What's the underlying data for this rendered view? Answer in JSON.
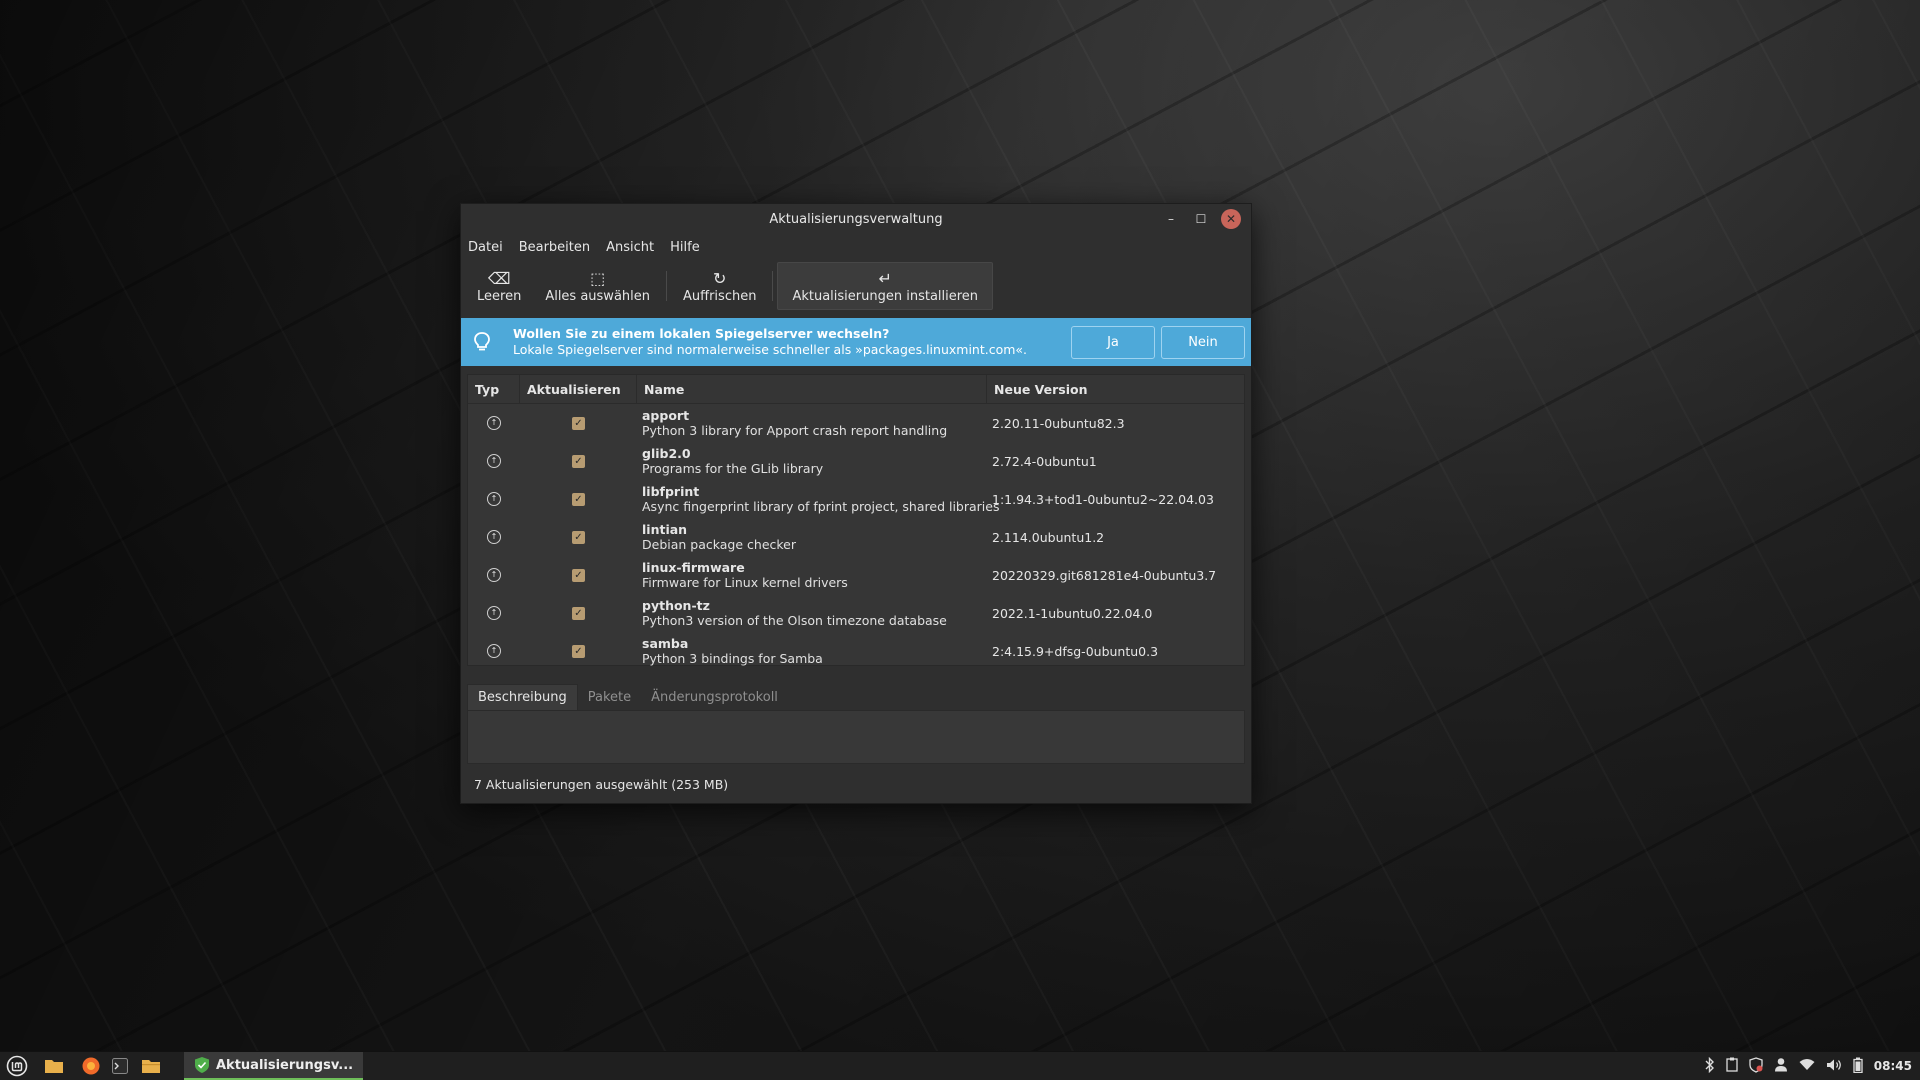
{
  "window": {
    "title": "Aktualisierungsverwaltung",
    "minimize": "–",
    "maximize": "☐",
    "close": "✕"
  },
  "menu": [
    "Datei",
    "Bearbeiten",
    "Ansicht",
    "Hilfe"
  ],
  "toolbar": {
    "clear": {
      "label": "Leeren",
      "icon": "⌫"
    },
    "select_all": {
      "label": "Alles auswählen",
      "icon": "⬚"
    },
    "refresh": {
      "label": "Auffrischen",
      "icon": "↻"
    },
    "install": {
      "label": "Aktualisierungen installieren",
      "icon": "↵"
    }
  },
  "infobar": {
    "title": "Wollen Sie zu einem lokalen Spiegelserver wechseln?",
    "text": "Lokale Spiegelserver sind normalerweise schneller als »packages.linuxmint.com«.",
    "yes": "Ja",
    "no": "Nein",
    "color": "#4ea9d9"
  },
  "table": {
    "headers": {
      "typ": "Typ",
      "aktualisieren": "Aktualisieren",
      "name": "Name",
      "version": "Neue Version"
    },
    "rows": [
      {
        "name": "apport",
        "desc": "Python 3 library for Apport crash report handling",
        "version": "2.20.11-0ubuntu82.3"
      },
      {
        "name": "glib2.0",
        "desc": "Programs for the GLib library",
        "version": "2.72.4-0ubuntu1"
      },
      {
        "name": "libfprint",
        "desc": "Async fingerprint library of fprint project, shared libraries",
        "version": "1:1.94.3+tod1-0ubuntu2~22.04.03"
      },
      {
        "name": "lintian",
        "desc": "Debian package checker",
        "version": "2.114.0ubuntu1.2"
      },
      {
        "name": "linux-firmware",
        "desc": "Firmware for Linux kernel drivers",
        "version": "20220329.git681281e4-0ubuntu3.7"
      },
      {
        "name": "python-tz",
        "desc": "Python3 version of the Olson timezone database",
        "version": "2022.1-1ubuntu0.22.04.0"
      },
      {
        "name": "samba",
        "desc": "Python 3 bindings for Samba",
        "version": "2:4.15.9+dfsg-0ubuntu0.3"
      }
    ]
  },
  "tabs": [
    "Beschreibung",
    "Pakete",
    "Änderungsprotokoll"
  ],
  "status": "7 Aktualisierungen ausgewählt (253 MB)",
  "taskbar": {
    "task_label": "Aktualisierungsv...",
    "clock": "08:45"
  }
}
